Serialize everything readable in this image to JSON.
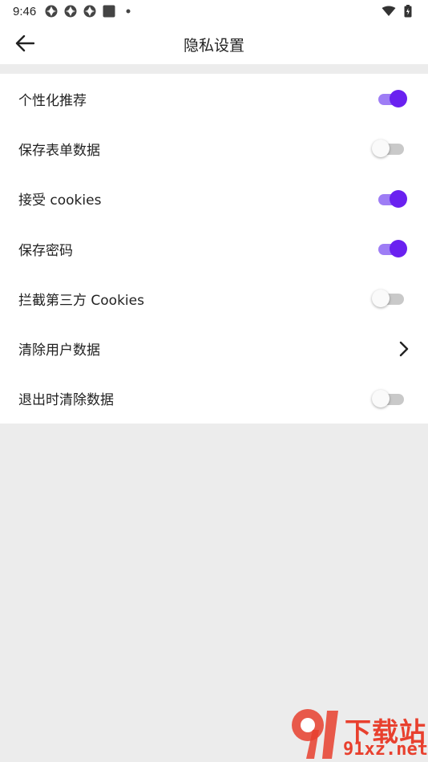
{
  "status_bar": {
    "time": "9:46"
  },
  "header": {
    "title": "隐私设置"
  },
  "settings": [
    {
      "label": "个性化推荐",
      "control": "toggle",
      "state": "on"
    },
    {
      "label": "保存表单数据",
      "control": "toggle",
      "state": "off"
    },
    {
      "label": "接受 cookies",
      "control": "toggle",
      "state": "on"
    },
    {
      "label": "保存密码",
      "control": "toggle",
      "state": "on"
    },
    {
      "label": "拦截第三方 Cookies",
      "control": "toggle",
      "state": "off"
    },
    {
      "label": "清除用户数据",
      "control": "chevron"
    },
    {
      "label": "退出时清除数据",
      "control": "toggle",
      "state": "off"
    }
  ],
  "watermark": {
    "line1": "下载站",
    "line2": "91xz.net"
  },
  "colors": {
    "accent": "#6a21f0",
    "accent_track": "#9e7df5",
    "off_track": "#c9c9c9",
    "page_background": "#ececec",
    "watermark": "#e8402e"
  }
}
